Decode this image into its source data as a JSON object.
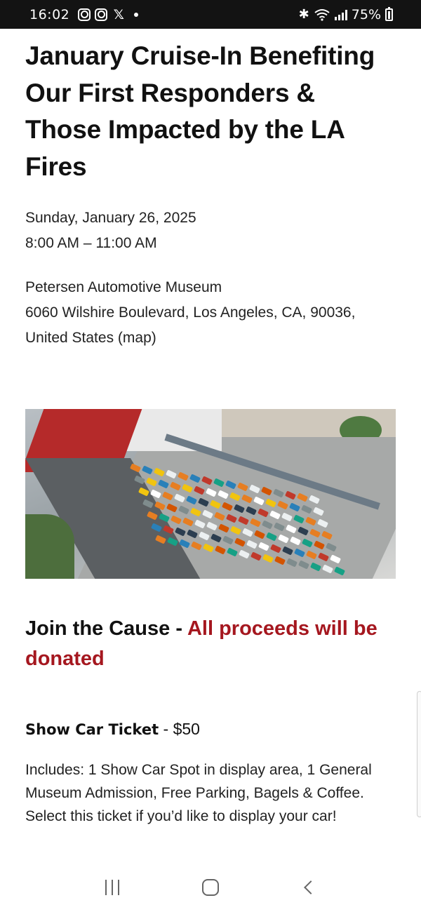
{
  "status_bar": {
    "time": "16:02",
    "notification_icons": [
      "instagram-icon",
      "instagram-icon",
      "x-icon",
      "dot-icon"
    ],
    "system_icons": [
      "bluetooth-icon",
      "wifi-icon",
      "signal-icon",
      "battery-icon"
    ],
    "battery": "75%"
  },
  "event": {
    "title": "January Cruise-In Benefiting Our First Responders & Those Impacted by the LA Fires",
    "date": "Sunday, January 26, 2025",
    "time": "8:00 AM – 11:00 AM",
    "venue": "Petersen Automotive Museum",
    "address_line": "6060 Wilshire Boulevard, Los Angeles, CA, 90036,",
    "address_country": "United States",
    "map_link": "(map)"
  },
  "section": {
    "heading_plain": "Join the Cause - ",
    "heading_accent": "All proceeds will be donated",
    "accent_color": "#a5171f"
  },
  "ticket": {
    "name": "Show Car Ticket",
    "price": " - $50",
    "description": "Includes: 1 Show Car Spot in display area, 1 General Museum Admission, Free Parking, Bagels & Coffee. Select this ticket if you’d like to display your car!"
  },
  "nav_bar": {
    "buttons": [
      "recents-icon",
      "home-icon",
      "back-icon"
    ]
  }
}
